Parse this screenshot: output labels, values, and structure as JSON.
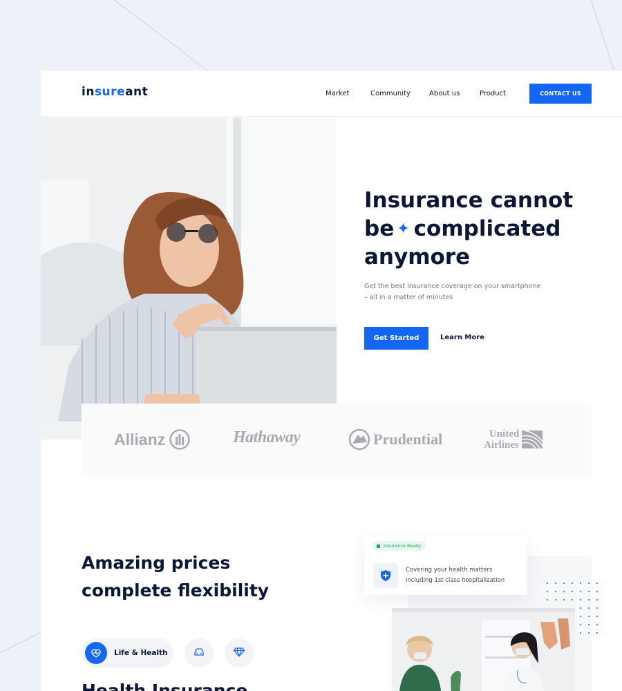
{
  "brand": {
    "logo_a": "in",
    "logo_b": "sure",
    "logo_c": "ant",
    "accent": "#1466f5"
  },
  "nav": {
    "items": [
      "Market",
      "Community",
      "About us",
      "Product"
    ],
    "cta": "CONTACT US"
  },
  "hero": {
    "title_line1": "Insurance cannot",
    "title_line2_a": "be",
    "title_line2_b": "complicated",
    "title_line3": "anymore",
    "subtitle_1": "Get the best insurance coverage on your smartphone",
    "subtitle_2": "– all in a matter of minutes",
    "primary_button": "Get Started",
    "secondary_button": "Learn More"
  },
  "partners": {
    "allianz": "Allianz",
    "hathaway": "Hathaway",
    "prudential": "Prudential",
    "united_1": "United",
    "united_2": "Airlines"
  },
  "section": {
    "title_1": "Amazing prices",
    "title_2": "complete flexibility",
    "tab_active": "Life & Health",
    "tab_icons": [
      "heart-pulse-icon",
      "car-icon",
      "diamond-icon"
    ],
    "next_heading": "Health Insurance"
  },
  "card": {
    "badge": "Insurance Ready",
    "text_1": "Covering your health matters",
    "text_2": "including 1st class hospitalization"
  }
}
